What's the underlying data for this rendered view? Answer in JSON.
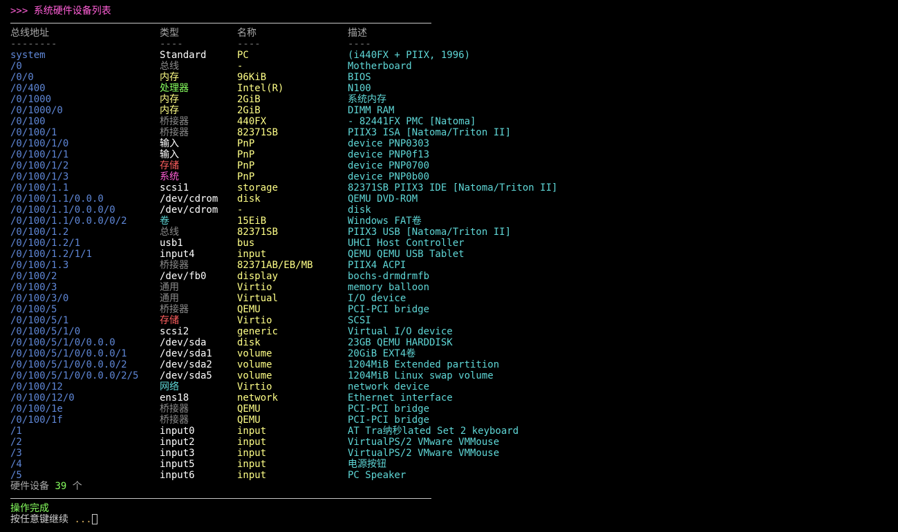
{
  "title": ">>> 系统硬件设备列表",
  "header": {
    "columns": [
      "总线地址",
      "类型",
      "名称",
      "描述"
    ],
    "underlines": [
      "--------",
      "----",
      "----",
      "----"
    ]
  },
  "colors": {
    "address": "#5f87d7",
    "name": "#ffff87",
    "description": "#5fd7d7",
    "title": "#ff5fd7",
    "success": "#87ff5f"
  },
  "rows": [
    {
      "address": "system",
      "type": "Standard",
      "type_color": "#ffffff",
      "name": "PC",
      "description": "(i440FX + PIIX, 1996)"
    },
    {
      "address": "/0",
      "type": "总线",
      "type_color": "#8a8a8a",
      "name": "-",
      "description": "Motherboard"
    },
    {
      "address": "/0/0",
      "type": "内存",
      "type_color": "#ffff87",
      "name": "96KiB",
      "description": "BIOS"
    },
    {
      "address": "/0/400",
      "type": "处理器",
      "type_color": "#87ff5f",
      "name": "Intel(R)",
      "description": "N100"
    },
    {
      "address": "/0/1000",
      "type": "内存",
      "type_color": "#ffff87",
      "name": "2GiB",
      "description": "系统内存"
    },
    {
      "address": "/0/1000/0",
      "type": "内存",
      "type_color": "#ffff87",
      "name": "2GiB",
      "description": "DIMM RAM"
    },
    {
      "address": "/0/100",
      "type": "桥接器",
      "type_color": "#8a8a8a",
      "name": "440FX",
      "description": "- 82441FX PMC [Natoma]"
    },
    {
      "address": "/0/100/1",
      "type": "桥接器",
      "type_color": "#8a8a8a",
      "name": "82371SB",
      "description": "PIIX3 ISA [Natoma/Triton II]"
    },
    {
      "address": "/0/100/1/0",
      "type": "输入",
      "type_color": "#ffffff",
      "name": "PnP",
      "description": "device PNP0303"
    },
    {
      "address": "/0/100/1/1",
      "type": "输入",
      "type_color": "#ffffff",
      "name": "PnP",
      "description": "device PNP0f13"
    },
    {
      "address": "/0/100/1/2",
      "type": "存储",
      "type_color": "#ff5f5f",
      "name": "PnP",
      "description": "device PNP0700"
    },
    {
      "address": "/0/100/1/3",
      "type": "系统",
      "type_color": "#ff5fd7",
      "name": "PnP",
      "description": "device PNP0b00"
    },
    {
      "address": "/0/100/1.1",
      "type": "scsi1",
      "type_color": "#ffffff",
      "name": "storage",
      "description": "82371SB PIIX3 IDE [Natoma/Triton II]"
    },
    {
      "address": "/0/100/1.1/0.0.0",
      "type": "/dev/cdrom",
      "type_color": "#ffffff",
      "name": "disk",
      "description": "QEMU DVD-ROM"
    },
    {
      "address": "/0/100/1.1/0.0.0/0",
      "type": "/dev/cdrom",
      "type_color": "#ffffff",
      "name": "-",
      "description": "disk"
    },
    {
      "address": "/0/100/1.1/0.0.0/0/2",
      "type": "卷",
      "type_color": "#5fd7d7",
      "name": "15EiB",
      "description": "Windows FAT卷"
    },
    {
      "address": "/0/100/1.2",
      "type": "总线",
      "type_color": "#8a8a8a",
      "name": "82371SB",
      "description": "PIIX3 USB [Natoma/Triton II]"
    },
    {
      "address": "/0/100/1.2/1",
      "type": "usb1",
      "type_color": "#ffffff",
      "name": "bus",
      "description": "UHCI Host Controller"
    },
    {
      "address": "/0/100/1.2/1/1",
      "type": "input4",
      "type_color": "#ffffff",
      "name": "input",
      "description": "QEMU QEMU USB Tablet"
    },
    {
      "address": "/0/100/1.3",
      "type": "桥接器",
      "type_color": "#8a8a8a",
      "name": "82371AB/EB/MB",
      "description": "PIIX4 ACPI"
    },
    {
      "address": "/0/100/2",
      "type": "/dev/fb0",
      "type_color": "#ffffff",
      "name": "display",
      "description": "bochs-drmdrmfb"
    },
    {
      "address": "/0/100/3",
      "type": "通用",
      "type_color": "#8a8a8a",
      "name": "Virtio",
      "description": "memory balloon"
    },
    {
      "address": "/0/100/3/0",
      "type": "通用",
      "type_color": "#8a8a8a",
      "name": "Virtual",
      "description": "I/O device"
    },
    {
      "address": "/0/100/5",
      "type": "桥接器",
      "type_color": "#8a8a8a",
      "name": "QEMU",
      "description": "PCI-PCI bridge"
    },
    {
      "address": "/0/100/5/1",
      "type": "存储",
      "type_color": "#ff5f5f",
      "name": "Virtio",
      "description": "SCSI"
    },
    {
      "address": "/0/100/5/1/0",
      "type": "scsi2",
      "type_color": "#ffffff",
      "name": "generic",
      "description": "Virtual I/O device"
    },
    {
      "address": "/0/100/5/1/0/0.0.0",
      "type": "/dev/sda",
      "type_color": "#ffffff",
      "name": "disk",
      "description": "23GB QEMU HARDDISK"
    },
    {
      "address": "/0/100/5/1/0/0.0.0/1",
      "type": "/dev/sda1",
      "type_color": "#ffffff",
      "name": "volume",
      "description": "20GiB EXT4卷"
    },
    {
      "address": "/0/100/5/1/0/0.0.0/2",
      "type": "/dev/sda2",
      "type_color": "#ffffff",
      "name": "volume",
      "description": "1204MiB Extended partition"
    },
    {
      "address": "/0/100/5/1/0/0.0.0/2/5",
      "type": "/dev/sda5",
      "type_color": "#ffffff",
      "name": "volume",
      "description": "1204MiB Linux swap volume"
    },
    {
      "address": "/0/100/12",
      "type": "网络",
      "type_color": "#5fd7d7",
      "name": "Virtio",
      "description": "network device"
    },
    {
      "address": "/0/100/12/0",
      "type": "ens18",
      "type_color": "#ffffff",
      "name": "network",
      "description": "Ethernet interface"
    },
    {
      "address": "/0/100/1e",
      "type": "桥接器",
      "type_color": "#8a8a8a",
      "name": "QEMU",
      "description": "PCI-PCI bridge"
    },
    {
      "address": "/0/100/1f",
      "type": "桥接器",
      "type_color": "#8a8a8a",
      "name": "QEMU",
      "description": "PCI-PCI bridge"
    },
    {
      "address": "/1",
      "type": "input0",
      "type_color": "#ffffff",
      "name": "input",
      "description": "AT Tra纳秒lated Set 2 keyboard"
    },
    {
      "address": "/2",
      "type": "input2",
      "type_color": "#ffffff",
      "name": "input",
      "description": "VirtualPS/2 VMware VMMouse"
    },
    {
      "address": "/3",
      "type": "input3",
      "type_color": "#ffffff",
      "name": "input",
      "description": "VirtualPS/2 VMware VMMouse"
    },
    {
      "address": "/4",
      "type": "input5",
      "type_color": "#ffffff",
      "name": "input",
      "description": "电源按钮"
    },
    {
      "address": "/5",
      "type": "input6",
      "type_color": "#ffffff",
      "name": "input",
      "description": "PC Speaker"
    }
  ],
  "summary": {
    "prefix": "硬件设备 ",
    "count": "39",
    "suffix": " 个"
  },
  "status": {
    "done": "操作完成",
    "prompt": "按任意键继续 ",
    "dots": "..."
  }
}
